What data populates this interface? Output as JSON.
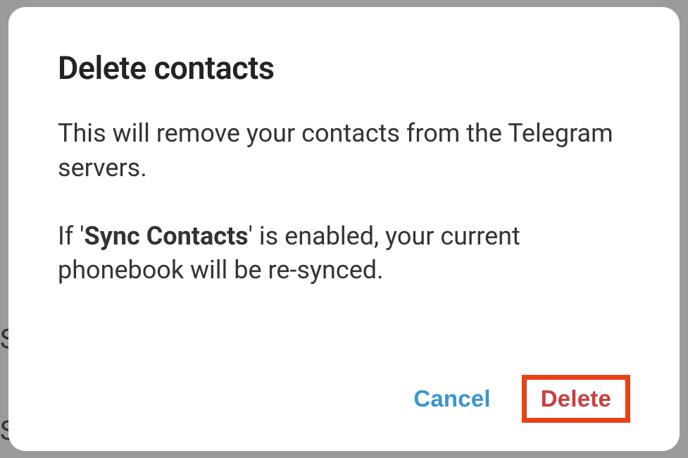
{
  "dialog": {
    "title": "Delete contacts",
    "message_part1": "This will remove your contacts from the Telegram servers.",
    "message_part2_prefix": "If '",
    "message_part2_bold": "Sync Contacts",
    "message_part2_suffix": "' is enabled, your current phonebook will be re-synced.",
    "cancel_label": "Cancel",
    "delete_label": "Delete"
  }
}
